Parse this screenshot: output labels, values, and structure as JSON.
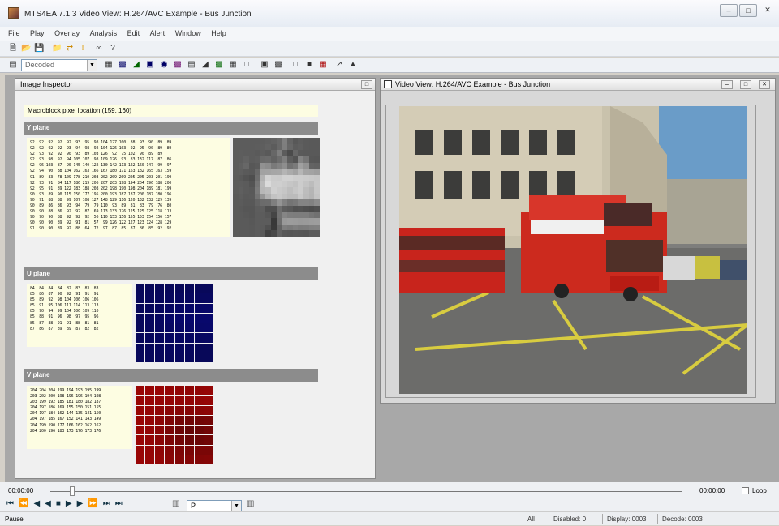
{
  "window": {
    "app_title": "MTS4EA 7.1.3",
    "doc_title": "Video View: H.264/AVC Example - Bus Junction"
  },
  "menu": [
    "File",
    "Play",
    "Overlay",
    "Analysis",
    "Edit",
    "Alert",
    "Window",
    "Help"
  ],
  "toolbar": {
    "mode_select": "Decoded"
  },
  "inspector": {
    "title": "Image Inspector",
    "mb_location": "Macroblock pixel location (159, 160)",
    "y_label": "Y plane",
    "u_label": "U plane",
    "v_label": "V plane",
    "y_rows": [
      "92  92  92  92  92  93  95  98 104 127 100  88  93  90  89  89",
      "92  92  92  92  93  94  98  92 104 126 103  92  95  90  89  89",
      "92  93  92  92  90  93  89 103 126  92  75 102  90  89  89",
      "92  93  98  92  94 105 107  98 109 126  93  83 132 117  87  86",
      "92  96 103  87  90 145 140 122 130 142 113 122 160 147  99  97",
      "92  94  90  88 104 162 163 166 167 180 171 163 182 165 163 159",
      "91  89  83  78 109 178 210 203 202 209 209 205 205 203 201 199",
      "92  93  91  84 117 186 219 206 207 203 198 194 204 196 188 200",
      "92  95  91  89 122 183 188 208 202 198 190 198 204 189 181 199",
      "90  93  89  90 115 150 177 195 200 193 187 187 200 187 180 196",
      "90  91  88  88  99 107 108 127 148 129 116 120 132 132 129 139",
      "90  89  86  86  93  94  79  79 110  93  89  81  83  79  76  80",
      "90  90  88  86  92  92  87  69 113 133 126 125 125 125 118 113",
      "90  90  90  88  92  92  92  56 110 153 156 155 153 154 156 157",
      "90  90  90  89  92  91  81  57  99 126 122 127 123 124 128 129",
      "91  90  90  89  92  88  64  72  97  87  85  87  86  85  92  92"
    ],
    "u_rows": [
      "84  84  84  84  82  83  83  83",
      "85  86  87  90  92  91  91  91",
      "85  89  92  98 104 106 106 106",
      "85  91  95 106 111 114 113 113",
      "85  90  94  99 104 106 109 110",
      "85  88  91  96  98  97  95  96",
      "85  87  88  91  91  88  81  81",
      "87  86  87  89  89  87  82  82"
    ],
    "v_rows": [
      "204 204 204 199 194 193 195 199",
      "203 202 200 198 196 196 194 198",
      "203 199 192 185 181 180 182 187",
      "204 197 186 169 155 150 151 155",
      "204 197 184 162 144 135 141 150",
      "204 197 185 167 152 141 143 149",
      "204 199 190 177 166 162 162 162",
      "204 200 196 183 173 176 173 176"
    ]
  },
  "video": {
    "title": "Video View: H.264/AVC Example - Bus Junction"
  },
  "timeline": {
    "start_time": "00:00:00",
    "end_time": "00:00:00",
    "loop_label": "Loop",
    "frame_type": "P"
  },
  "status": {
    "left": "Pause",
    "all": "All",
    "disabled": "Disabled: 0",
    "display": "Display: 0003",
    "decode": "Decode: 0003"
  },
  "colors": {
    "u_tile": "#0a0a5a",
    "v_tile": "#8b0a0a"
  }
}
